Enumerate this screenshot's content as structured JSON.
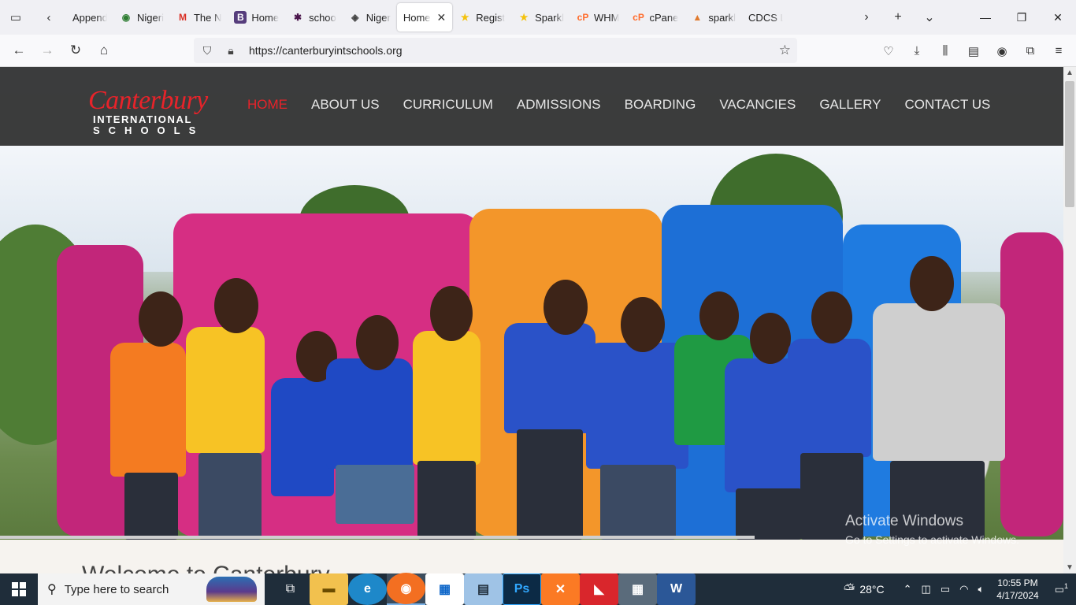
{
  "browser": {
    "tabs": [
      {
        "title": "Append B",
        "favicon": "generic-page-icon",
        "fav_char": ""
      },
      {
        "title": "Nigeri",
        "favicon": "nigeria-crest-icon",
        "fav_char": "◉"
      },
      {
        "title": "The N",
        "favicon": "gmail-icon",
        "fav_char": "M"
      },
      {
        "title": "Home",
        "favicon": "bootstrap-icon",
        "fav_char": "B"
      },
      {
        "title": "schoo",
        "favicon": "slack-icon",
        "fav_char": "✱"
      },
      {
        "title": "Niger",
        "favicon": "eye-logo-icon",
        "fav_char": "◈"
      },
      {
        "title": "Home",
        "favicon": "none",
        "fav_char": "",
        "active": true
      },
      {
        "title": "Regist",
        "favicon": "star-icon",
        "fav_char": "★"
      },
      {
        "title": "Sparkl",
        "favicon": "star-icon",
        "fav_char": "★"
      },
      {
        "title": "WHM",
        "favicon": "cpanel-icon",
        "fav_char": "cP"
      },
      {
        "title": "cPane",
        "favicon": "cpanel-icon",
        "fav_char": "cP"
      },
      {
        "title": "sparkl",
        "favicon": "mountain-icon",
        "fav_char": "▲"
      },
      {
        "title": "CDCS Log",
        "favicon": "none",
        "fav_char": ""
      }
    ],
    "url": "https://canterburyintschools.org"
  },
  "site": {
    "logo_line1": "Canterbury",
    "logo_line2": "INTERNATIONAL",
    "logo_line3": "SCHOOLS",
    "menu": [
      "HOME",
      "ABOUT US",
      "CURRICULUM",
      "ADMISSIONS",
      "BOARDING",
      "VACANCIES",
      "GALLERY",
      "CONTACT US"
    ],
    "welcome": "Welcome to Canterbury",
    "watermark_line1": "Activate Windows",
    "watermark_line2": "Go to Settings to activate Windows."
  },
  "taskbar": {
    "search_placeholder": "Type here to search",
    "weather": "28°C",
    "time": "10:55 PM",
    "date": "4/17/2024",
    "notifications": "1"
  },
  "colors": {
    "brand_red": "#e8232a",
    "header_bg": "#2d2d2d"
  }
}
